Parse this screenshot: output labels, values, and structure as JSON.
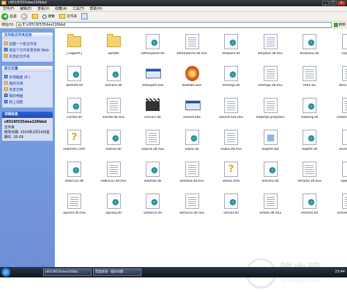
{
  "window": {
    "title": "c8519f335dee226bbd",
    "buttons": [
      "_",
      "□",
      "×"
    ]
  },
  "menu": [
    "文件(F)",
    "编辑(E)",
    "查看(V)",
    "收藏(A)",
    "工具(T)",
    "帮助(H)"
  ],
  "toolbar": {
    "back_label": "后退",
    "search_label": "搜索",
    "folders_label": "文件夹"
  },
  "address": {
    "label": "地址(D)",
    "value": "E:\\c8519f335dee226bbd",
    "go_label": "转到"
  },
  "sidebar": {
    "tasks": {
      "header": "文件和文件夹任务",
      "items": [
        "创建一个新文件夹",
        "将这个文件夹发布到 Web",
        "共享此文件夹"
      ]
    },
    "places": {
      "header": "其它位置",
      "items": [
        "本地磁盘 (E:)",
        "我的文档",
        "共享文档",
        "我的电脑",
        "网上邻居"
      ]
    },
    "details": {
      "header": "详细信息",
      "name": "c8519f335dee226bbd",
      "type": "文件夹",
      "modified": "修改日期: 2010年2月14日星期日, 20:29"
    }
  },
  "files": [
    {
      "name": "support",
      "kind": "folder",
      "selected": true
    },
    {
      "name": "update",
      "kind": "folder"
    },
    {
      "name": "adminparse.dll",
      "kind": "dll-gear"
    },
    {
      "name": "adminparse.dll.mui",
      "kind": "doc"
    },
    {
      "name": "advpack.dll",
      "kind": "dll-gear"
    },
    {
      "name": "advpack.dll.mui",
      "kind": "doc"
    },
    {
      "name": "browseui.dll",
      "kind": "dll-gear"
    },
    {
      "name": "corpol.dll",
      "kind": "dll-gear"
    },
    {
      "name": "dxtmsft.dll",
      "kind": "dll-gear"
    },
    {
      "name": "dxtrans.dll",
      "kind": "dll-gear"
    },
    {
      "name": "extexport.exe",
      "kind": "exe"
    },
    {
      "name": "feedsbs.wav",
      "kind": "wav"
    },
    {
      "name": "hmmapi.dll",
      "kind": "dll-gear"
    },
    {
      "name": "hmmapi.dll.mui",
      "kind": "doc"
    },
    {
      "name": "html.iec",
      "kind": "doc"
    },
    {
      "name": "html.iec.mui",
      "kind": "doc"
    },
    {
      "name": "icardie.dll",
      "kind": "dll-gear"
    },
    {
      "name": "icardie.dll.mui",
      "kind": "doc"
    },
    {
      "name": "icsrv03.rat",
      "kind": "clap"
    },
    {
      "name": "iexunit.exe",
      "kind": "exe"
    },
    {
      "name": "iexunit.exe.mui",
      "kind": "doc"
    },
    {
      "name": "iedpmps.propdesc",
      "kind": "doc"
    },
    {
      "name": "ieakeng.dll",
      "kind": "dll-gear"
    },
    {
      "name": "ieakeng.dll.mui",
      "kind": "doc"
    },
    {
      "name": "ieakmmc.chm",
      "kind": "help"
    },
    {
      "name": "ieaksie.dll",
      "kind": "dll-gear"
    },
    {
      "name": "ieaksie.dll.mui",
      "kind": "doc"
    },
    {
      "name": "ieakui.dll",
      "kind": "dll-gear"
    },
    {
      "name": "ieakui.dll.mui",
      "kind": "doc"
    },
    {
      "name": "ieapfltr.dat",
      "kind": "dat"
    },
    {
      "name": "ieapfltr.dll",
      "kind": "dll-gear"
    },
    {
      "name": "iecompat.dll",
      "kind": "dll-gear"
    },
    {
      "name": "iedkcs32.dll",
      "kind": "dll-gear"
    },
    {
      "name": "iedkcs32.dll.mui",
      "kind": "doc"
    },
    {
      "name": "iedvtool.dll",
      "kind": "dll-gear"
    },
    {
      "name": "iedvtool.dll.mui",
      "kind": "doc"
    },
    {
      "name": "ieelua.chm",
      "kind": "help"
    },
    {
      "name": "ieframe.dll",
      "kind": "dll-gear"
    },
    {
      "name": "ieframe.dll.mui",
      "kind": "doc"
    },
    {
      "name": "iepeers.dll",
      "kind": "dll-gear"
    },
    {
      "name": "iepeers.dll.mui",
      "kind": "doc"
    },
    {
      "name": "ieproxy.dll",
      "kind": "dll-gear"
    },
    {
      "name": "iemonce.dll",
      "kind": "dll-gear"
    },
    {
      "name": "iemonce.dll.mui",
      "kind": "doc"
    },
    {
      "name": "iertutil.dll",
      "kind": "dll-gear"
    },
    {
      "name": "iertutil.dll.mui",
      "kind": "doc"
    },
    {
      "name": "ieshims.dll",
      "kind": "dll-gear"
    },
    {
      "name": "ieshims.dll.mui",
      "kind": "doc"
    }
  ],
  "taskbar": {
    "tasks": [
      "c8519f335dee226bb...",
      "百度知道 - 提问问题 ..."
    ],
    "clock": "23:44"
  },
  "watermark": {
    "title": "路由器",
    "url": "luyouqi.com"
  }
}
